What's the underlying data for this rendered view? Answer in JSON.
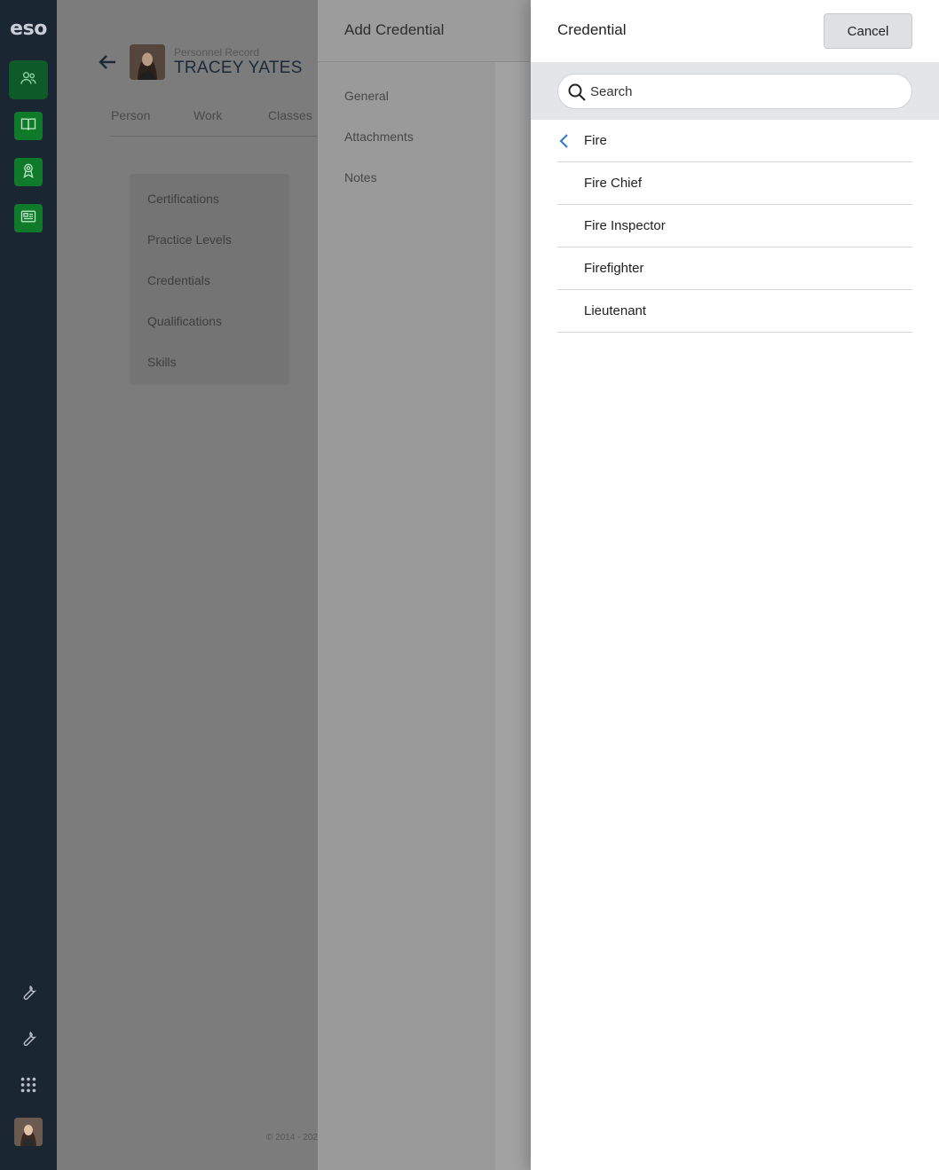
{
  "rail": {
    "logo": "eso",
    "nav": [
      "people-icon",
      "book-icon",
      "award-icon",
      "news-icon"
    ],
    "tools": [
      "wrench-icon",
      "wrench-icon",
      "apps-grid-icon"
    ],
    "accent": "#0f7a2a"
  },
  "background_page": {
    "record_label": "Personnel Record",
    "person_name": "TRACEY YATES",
    "tabs": [
      "Person",
      "Work",
      "Classes"
    ],
    "subnav": [
      "Certifications",
      "Practice Levels",
      "Credentials",
      "Qualifications",
      "Skills"
    ],
    "footer": "© 2014 - 202"
  },
  "add_credential": {
    "title": "Add Credential",
    "menu": [
      "General",
      "Attachments",
      "Notes"
    ]
  },
  "credential_panel": {
    "title": "Credential",
    "cancel_label": "Cancel",
    "search_placeholder": "Search",
    "back_item": "Fire",
    "items": [
      "Fire Chief",
      "Fire Inspector",
      "Firefighter",
      "Lieutenant"
    ],
    "chevron_color": "#3a7bd5"
  }
}
